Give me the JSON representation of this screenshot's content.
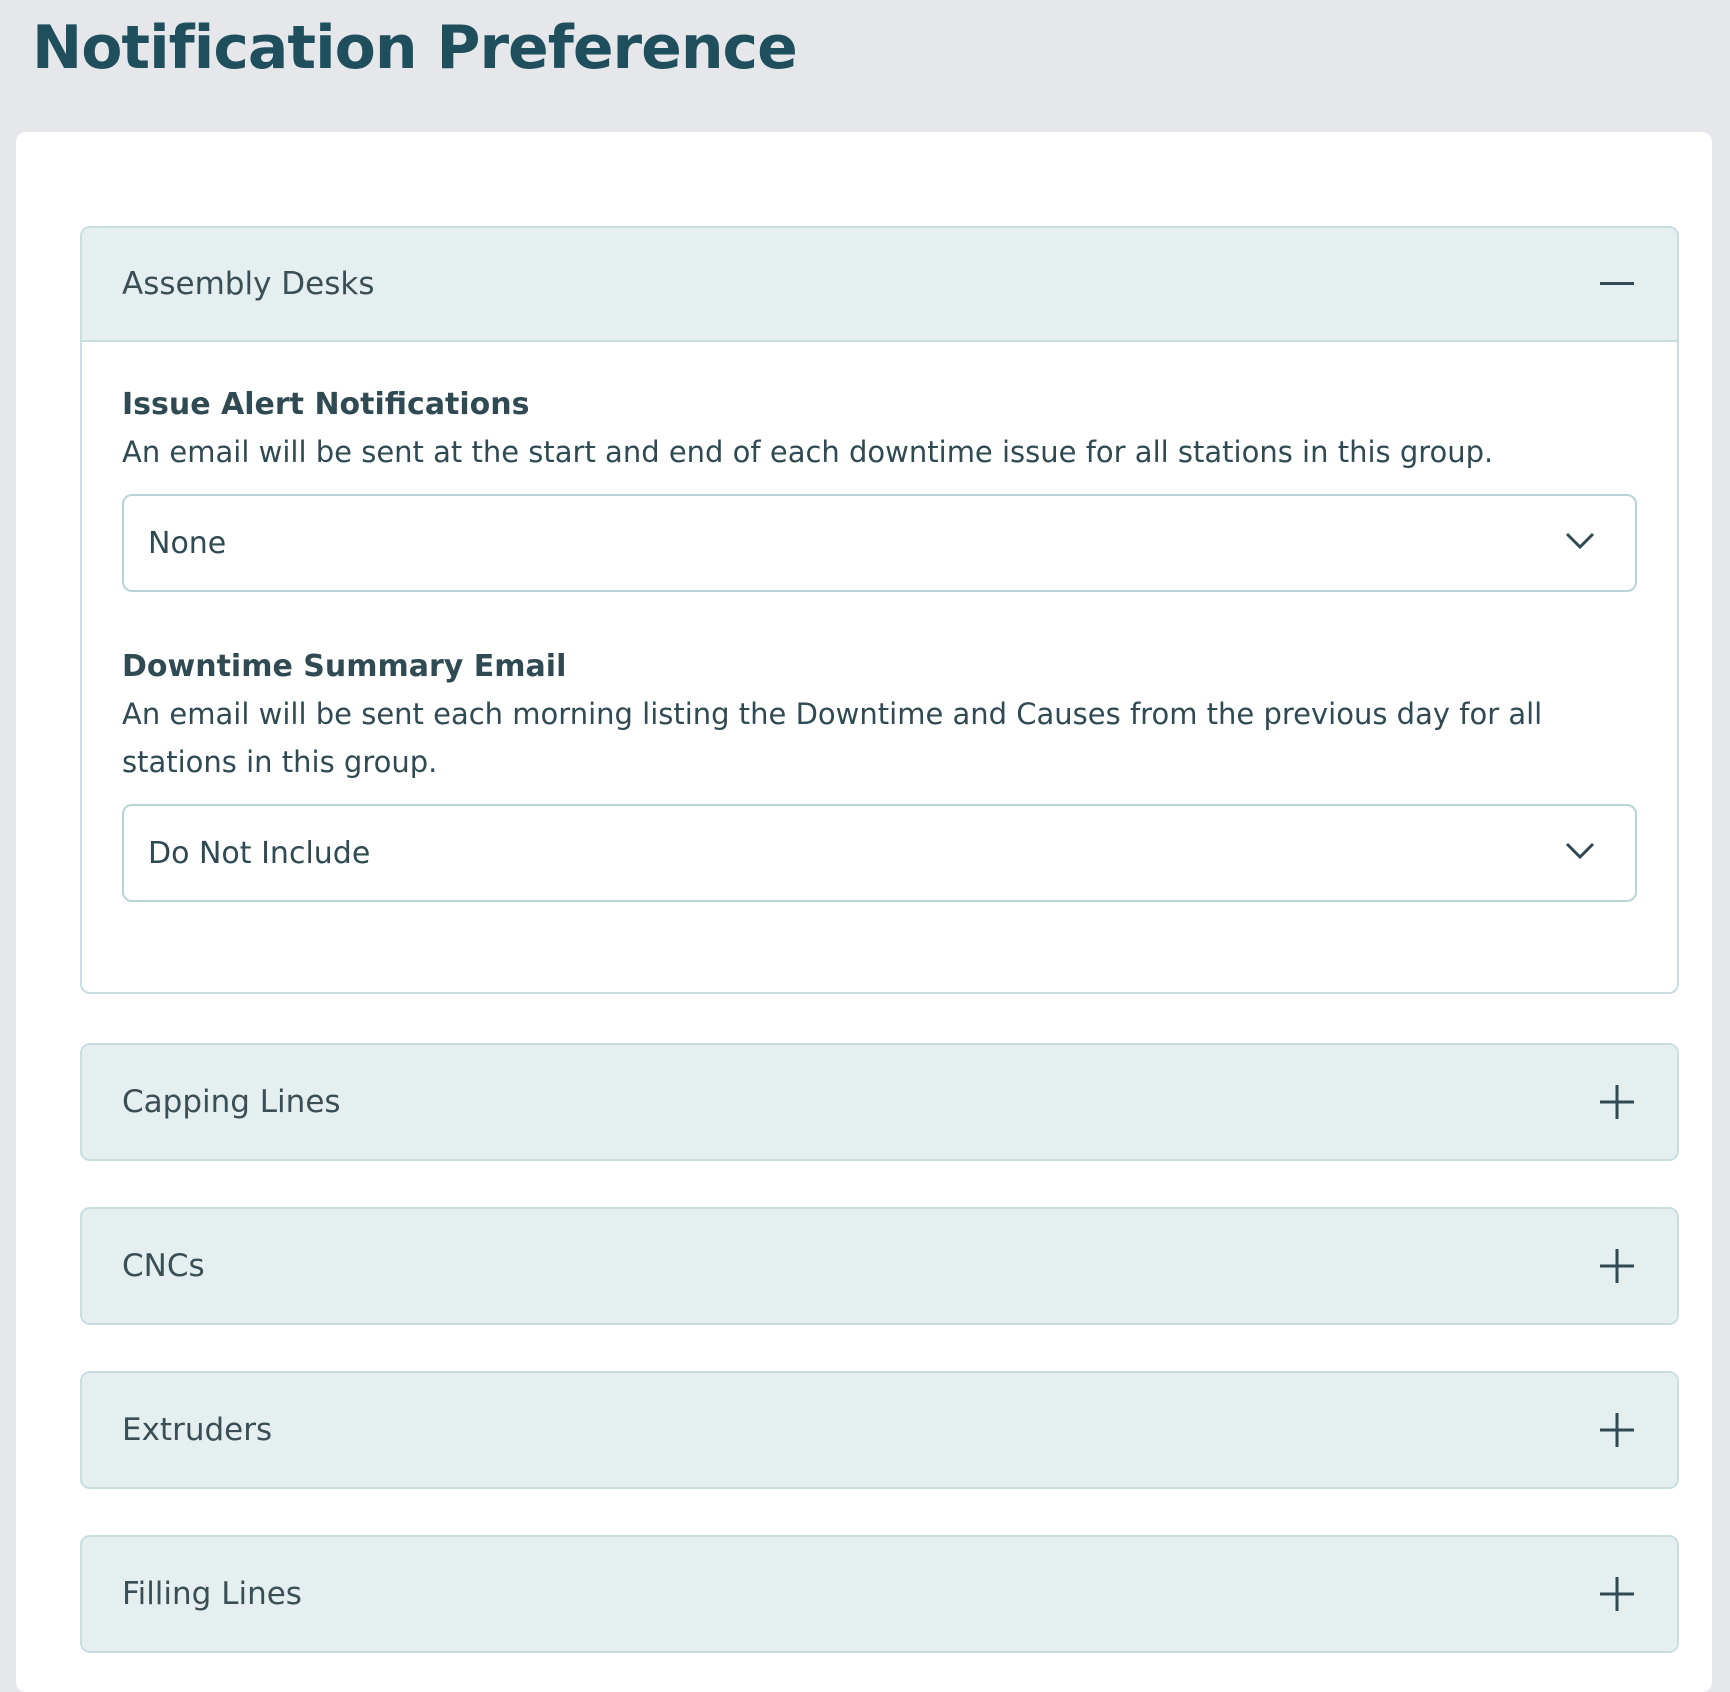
{
  "page": {
    "title": "Notification Preference"
  },
  "accordions": [
    {
      "title": "Assembly Desks",
      "toggle_icon": "minus-icon",
      "expanded": true,
      "fields": [
        {
          "label": "Issue Alert Notifications",
          "description": "An email will be sent at the start and end of each downtime issue for all stations in this group.",
          "selected": "None"
        },
        {
          "label": "Downtime Summary Email",
          "description": "An email will be sent each morning listing the Downtime and Causes from the previous day for all stations in this group.",
          "selected": "Do Not Include"
        }
      ]
    },
    {
      "title": "Capping Lines",
      "toggle_icon": "plus-icon",
      "expanded": false
    },
    {
      "title": "CNCs",
      "toggle_icon": "plus-icon",
      "expanded": false
    },
    {
      "title": "Extruders",
      "toggle_icon": "plus-icon",
      "expanded": false
    },
    {
      "title": "Filling Lines",
      "toggle_icon": "plus-icon",
      "expanded": false
    }
  ],
  "colors": {
    "background": "#e5e7eb",
    "title": "#1f4f5c",
    "header_bg": "#e6eff0",
    "border": "#c9dde0",
    "text": "#2f4a52"
  }
}
